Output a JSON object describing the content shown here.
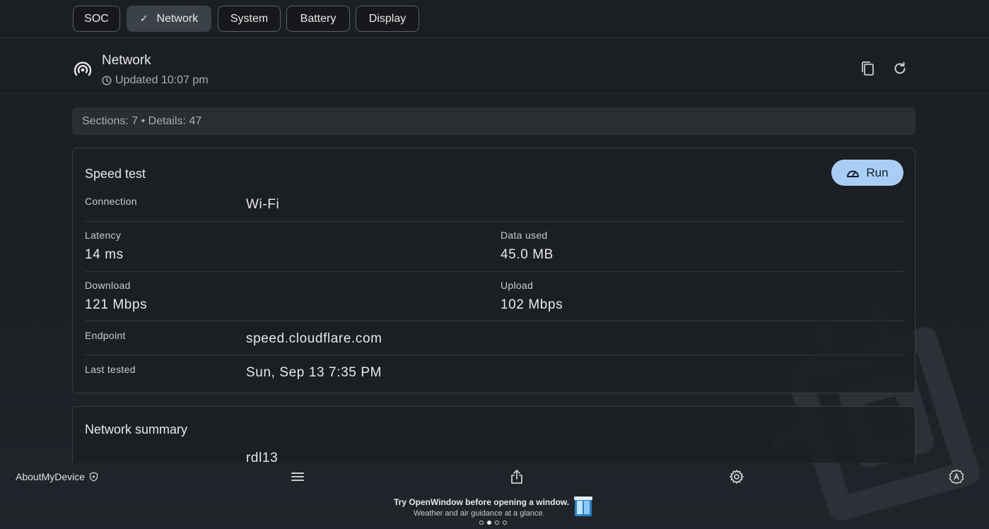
{
  "tabs": [
    {
      "label": "SOC",
      "active": false
    },
    {
      "label": "Network",
      "active": true
    },
    {
      "label": "System",
      "active": false
    },
    {
      "label": "Battery",
      "active": false
    },
    {
      "label": "Display",
      "active": false
    }
  ],
  "header": {
    "title": "Network",
    "updated": "Updated 10:07 pm",
    "icon": "network-signal-icon",
    "actions": [
      "copy-icon",
      "refresh-icon"
    ]
  },
  "summary": "Sections: 7 • Details: 47",
  "speed_test": {
    "title": "Speed test",
    "run_label": "Run",
    "connection_label": "Connection",
    "connection_value": "Wi-Fi",
    "latency_label": "Latency",
    "latency_value": "14 ms",
    "data_used_label": "Data used",
    "data_used_value": "45.0 MB",
    "download_label": "Download",
    "download_value": "121 Mbps",
    "upload_label": "Upload",
    "upload_value": "102 Mbps",
    "endpoint_label": "Endpoint",
    "endpoint_value": "speed.cloudflare.com",
    "last_tested_label": "Last tested",
    "last_tested_value": "Sun, Sep 13 7:35 PM"
  },
  "network_summary": {
    "title": "Network summary",
    "first_value": "rdl13"
  },
  "bottom": {
    "app_name": "AboutMyDevice",
    "promo_title": "Try OpenWindow before opening a window.",
    "promo_sub": "Weather and air guidance at a glance.",
    "page_dots": 4,
    "active_dot": 2
  },
  "colors": {
    "background": "#1b1e22",
    "accent": "#a9cdf5",
    "active_tab": "#3b4148"
  }
}
